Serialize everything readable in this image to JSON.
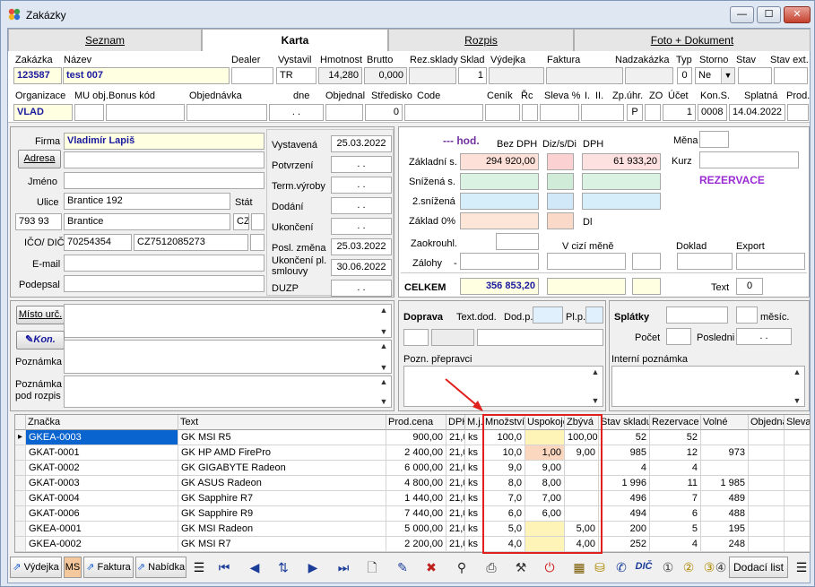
{
  "window": {
    "title": "Zakázky",
    "btn_min": "—",
    "btn_max": "☐",
    "btn_close": "✕"
  },
  "tabs": [
    "Seznam",
    "Karta",
    "Rozpis",
    "Foto + Dokument"
  ],
  "header": {
    "labels": {
      "zakazka": "Zakázka",
      "nazev": "Název",
      "dealer": "Dealer",
      "vystavil": "Vystavil",
      "hmotnost": "Hmotnost",
      "brutto": "Brutto",
      "rez_sklady": "Rez.sklady",
      "sklad": "Sklad",
      "vydejka": "Výdejka",
      "faktura": "Faktura",
      "nadzakazka": "Nadzakázka",
      "typ": "Typ",
      "storno": "Storno",
      "stav": "Stav",
      "stav_ext": "Stav ext."
    },
    "values": {
      "zakazka": "123587",
      "nazev": "test 007",
      "dealer": "",
      "vystavil": "TR",
      "hmotnost": "14,280",
      "brutto": "0,000",
      "rez_sklady": "",
      "sklad": "1",
      "typ": "0",
      "storno": "Ne"
    },
    "labels2": {
      "organizace": "Organizace",
      "mu_obj": "MU obj.",
      "bonus_kod": "Bonus kód",
      "objednavka": "Objednávka",
      "dne": "dne",
      "objednal": "Objednal",
      "stredisko": "Středisko",
      "code": "Code",
      "cenik": "Ceník",
      "rc": "Řc",
      "sleva": "Sleva %",
      "l": "I.",
      "ll": "II.",
      "zp_uhr": "Zp.úhr.",
      "zo": "ZO",
      "ucet": "Účet",
      "kon_s": "Kon.S.",
      "splatna": "Splatná",
      "prod": "Prod."
    },
    "values2": {
      "organizace": "VLAD",
      "dne": ". .",
      "stredisko": "0",
      "zp_uhr": "P",
      "ucet": "1",
      "kon_s": "0008",
      "splatna": "14.04.2022"
    }
  },
  "customer": {
    "firma_label": "Firma",
    "firma": "Vladimír Lapiš",
    "adresa_btn": "Adresa",
    "jmeno_label": "Jméno",
    "ulice_label": "Ulice",
    "ulice": "Brantice 192",
    "stat_label": "Stát",
    "psc": "793 93",
    "mesto": "Brantice",
    "stat": "CZ",
    "ico_label": "IČO/ DIČ",
    "ico": "70254354",
    "dic": "CZ7512085273",
    "email_label": "E-mail",
    "podepsal_label": "Podepsal"
  },
  "dates": [
    {
      "label": "Vystavená",
      "value": "25.03.2022"
    },
    {
      "label": "Potvrzení",
      "value": ". ."
    },
    {
      "label": "Term.výroby",
      "value": ". ."
    },
    {
      "label": "Dodání",
      "value": ". ."
    },
    {
      "label": "Ukončení",
      "value": ". ."
    },
    {
      "label": "Posl. změna",
      "value": "25.03.2022"
    },
    {
      "label": "Ukončení pl. smlouvy",
      "value": "30.06.2022"
    },
    {
      "label": "DUZP",
      "value": ". ."
    }
  ],
  "price": {
    "hod": "--- hod.",
    "bez_dph": "Bez DPH",
    "diz": "Diz/s/Di",
    "dph": "DPH",
    "mena": "Měna",
    "kurz": "Kurz",
    "rezervace": "REZERVACE",
    "zakladni": "Základní s.",
    "zakladni_bez": "294 920,00",
    "zakladni_dph": "61 933,20",
    "snizena": "Snížená s.",
    "snizena2": "2.snížená",
    "zaklad0": "Základ 0%",
    "dl": "Dl",
    "zaokrouhl": "Zaokrouhl.",
    "v_cizi": "V cizí měně",
    "doklad": "Doklad",
    "export": "Export",
    "zalohy": "Zálohy",
    "zalohy_dash": "-",
    "celkem": "CELKEM",
    "celkem_val": "356 853,20",
    "text": "Text",
    "text_val": "0"
  },
  "misc": {
    "misto_urc": "Místo urč.",
    "kon": "Kon.",
    "poznamka": "Poznámka",
    "poznamka_rozpis": "Poznámka pod rozpis",
    "doprava": "Doprava",
    "text_dod": "Text.dod.",
    "dod_p": "Dod.p.",
    "pl_p": "Pl.p.",
    "pozn_prepravci": "Pozn. přepravci",
    "splatky": "Splátky",
    "mesic": "měsíc.",
    "pocet": "Počet",
    "posledni": "Posledni",
    "posledni_val": ". .",
    "interni": "Interní poznámka"
  },
  "grid": {
    "columns": [
      "Značka",
      "Text",
      "Prod.cena",
      "DPH",
      "M.j.",
      "Množství",
      "Uspokoje",
      "Zbývá",
      "Stav skladu",
      "Rezervace",
      "Volné",
      "Objedná",
      "Sleva"
    ],
    "rows": [
      [
        "GKEA-0003",
        "GK MSI R5",
        "900,00",
        "21,0",
        "ks",
        "100,0",
        "",
        "100,00",
        "52",
        "52",
        ""
      ],
      [
        "GKAT-0001",
        "GK HP AMD FirePro",
        "2 400,00",
        "21,0",
        "ks",
        "10,0",
        "1,00",
        "9,00",
        "985",
        "12",
        "973"
      ],
      [
        "GKAT-0002",
        "GK  GIGABYTE Radeon",
        "6 000,00",
        "21,0",
        "ks",
        "9,0",
        "9,00",
        "",
        "4",
        "4",
        ""
      ],
      [
        "GKAT-0003",
        "GK ASUS Radeon",
        "4 800,00",
        "21,0",
        "ks",
        "8,0",
        "8,00",
        "",
        "1 996",
        "11",
        "1 985"
      ],
      [
        "GKAT-0004",
        "GK Sapphire R7",
        "1 440,00",
        "21,0",
        "ks",
        "7,0",
        "7,00",
        "",
        "496",
        "7",
        "489"
      ],
      [
        "GKAT-0006",
        "GK Sapphire R9",
        "7 440,00",
        "21,0",
        "ks",
        "6,0",
        "6,00",
        "",
        "494",
        "6",
        "488"
      ],
      [
        "GKEA-0001",
        "GK MSI  Radeon",
        "5 000,00",
        "21,0",
        "ks",
        "5,0",
        "",
        "5,00",
        "200",
        "5",
        "195"
      ],
      [
        "GKEA-0002",
        "GK MSI R7",
        "2 200,00",
        "21,0",
        "ks",
        "4,0",
        "",
        "4,00",
        "252",
        "4",
        "248"
      ]
    ]
  },
  "toolbar": {
    "vydejka": "Výdejka",
    "ms": "MS",
    "faktura": "Faktura",
    "nabidka": "Nabídka",
    "dic": "DIČ",
    "dodaci": "Dodací list"
  },
  "colors": {
    "highlight": "#e0201c",
    "selection": "#0a64d0"
  }
}
